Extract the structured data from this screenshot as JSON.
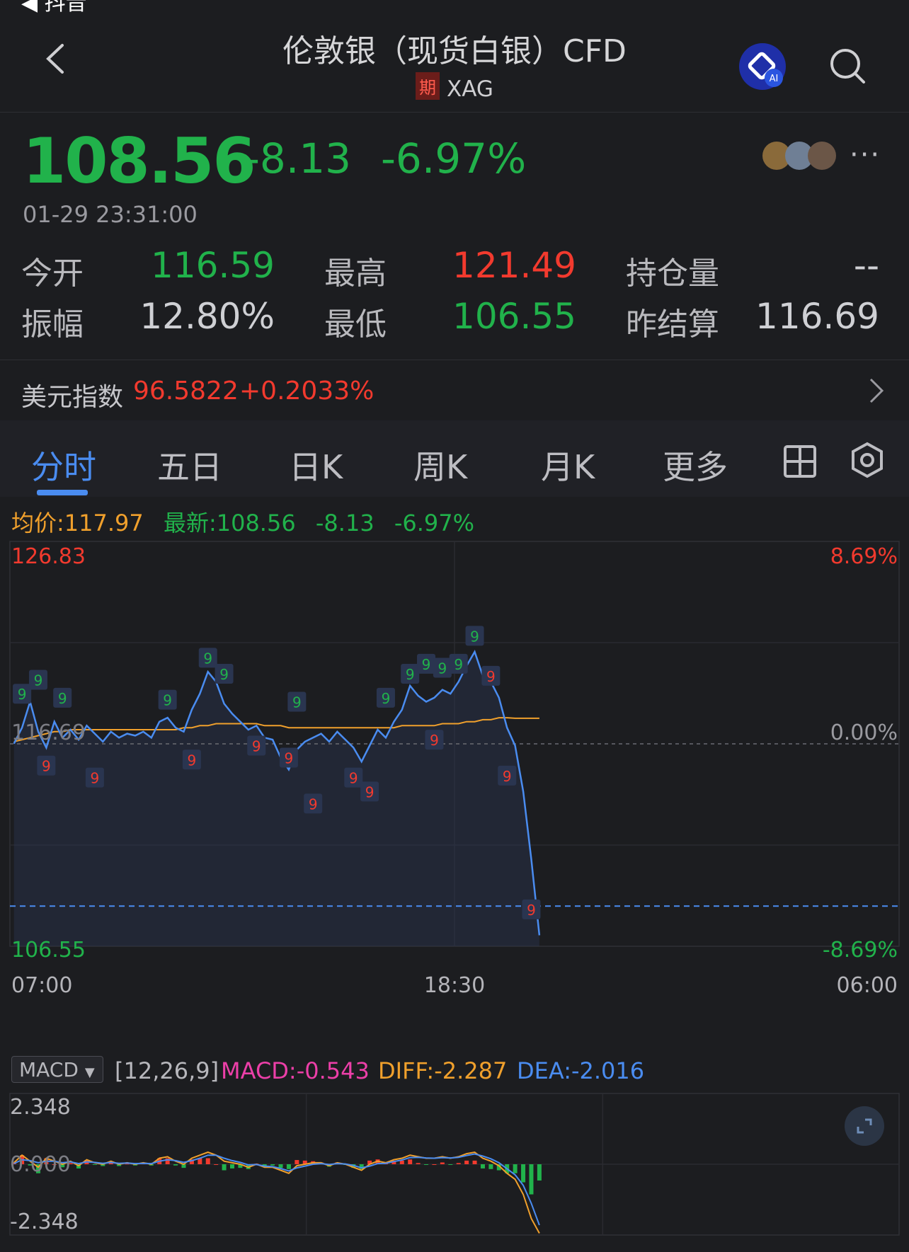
{
  "status_bar": {
    "back_app": "◀ 抖音"
  },
  "header": {
    "title": "伦敦银（现货白银）CFD",
    "tag": "期",
    "symbol": "XAG"
  },
  "quote": {
    "price": "108.56",
    "change": "-8.13",
    "change_pct": "-6.97%",
    "time": "01-29 23:31:00",
    "more": "···",
    "stats": [
      {
        "label": "今开",
        "value": "116.59",
        "color": "green"
      },
      {
        "label": "最高",
        "value": "121.49",
        "color": "red"
      },
      {
        "label": "持仓量",
        "value": "--",
        "color": "grey"
      },
      {
        "label": "振幅",
        "value": "12.80%",
        "color": "grey"
      },
      {
        "label": "最低",
        "value": "106.55",
        "color": "green"
      },
      {
        "label": "昨结算",
        "value": "116.69",
        "color": "grey"
      }
    ]
  },
  "usd_index": {
    "label": "美元指数",
    "value": "96.5822",
    "change_pct": "+0.2033%"
  },
  "tabs": [
    "分时",
    "五日",
    "日K",
    "周K",
    "月K",
    "更多"
  ],
  "legend": {
    "avg": "均价:117.97",
    "latest": "最新:108.56",
    "change": "-8.13",
    "pct": "-6.97%"
  },
  "chart_data": {
    "type": "line",
    "y_max_label": "126.83",
    "y_min_label": "106.55",
    "y_mid_label": "116.69",
    "pct_max_label": "8.69%",
    "pct_mid_label": "0.00%",
    "pct_min_label": "-8.69%",
    "x_labels": [
      "07:00",
      "18:30",
      "06:00"
    ],
    "ylim": [
      106.55,
      126.83
    ],
    "prev_settle": 116.69,
    "current": 108.56,
    "series": [
      {
        "values": [
          116.7,
          117.5,
          118.8,
          117.3,
          116.5,
          117.8,
          117.0,
          117.4,
          116.9,
          117.6,
          117.2,
          116.8,
          117.3,
          117.0,
          117.2,
          117.1,
          117.3,
          117.0,
          117.8,
          118.0,
          117.5,
          117.3,
          118.4,
          119.2,
          120.3,
          119.8,
          118.7,
          118.2,
          117.8,
          117.4,
          117.6,
          117.0,
          116.9,
          116.0,
          115.4,
          116.4,
          116.8,
          117.0,
          117.2,
          116.8,
          117.3,
          116.9,
          116.5,
          115.8,
          116.6,
          117.4,
          117.0,
          117.8,
          118.4,
          119.6,
          119.1,
          118.8,
          119.0,
          119.4,
          119.2,
          119.8,
          120.6,
          121.3,
          120.1,
          119.8,
          119.0,
          117.5,
          116.6,
          114.3,
          110.9,
          107.1
        ]
      },
      {
        "values": [
          116.8,
          116.9,
          117.0,
          117.1,
          117.2,
          117.3,
          117.3,
          117.4,
          117.4,
          117.4,
          117.4,
          117.4,
          117.4,
          117.4,
          117.4,
          117.4,
          117.4,
          117.4,
          117.4,
          117.4,
          117.4,
          117.5,
          117.5,
          117.6,
          117.6,
          117.7,
          117.7,
          117.7,
          117.7,
          117.7,
          117.7,
          117.6,
          117.6,
          117.6,
          117.5,
          117.5,
          117.5,
          117.5,
          117.5,
          117.5,
          117.5,
          117.5,
          117.5,
          117.5,
          117.5,
          117.5,
          117.5,
          117.5,
          117.6,
          117.6,
          117.6,
          117.6,
          117.6,
          117.7,
          117.7,
          117.7,
          117.8,
          117.8,
          117.9,
          117.9,
          118.0,
          118.0,
          117.97,
          117.97,
          117.97,
          117.97
        ]
      }
    ],
    "markers": [
      {
        "i": 1,
        "v": 119.2,
        "c": "g"
      },
      {
        "i": 3,
        "v": 119.9,
        "c": "g"
      },
      {
        "i": 4,
        "v": 115.6,
        "c": "r"
      },
      {
        "i": 6,
        "v": 119.0,
        "c": "g"
      },
      {
        "i": 10,
        "v": 115.0,
        "c": "r"
      },
      {
        "i": 19,
        "v": 118.9,
        "c": "g"
      },
      {
        "i": 22,
        "v": 115.9,
        "c": "r"
      },
      {
        "i": 24,
        "v": 121.0,
        "c": "g"
      },
      {
        "i": 26,
        "v": 120.2,
        "c": "g"
      },
      {
        "i": 30,
        "v": 116.6,
        "c": "r"
      },
      {
        "i": 34,
        "v": 116.0,
        "c": "r"
      },
      {
        "i": 35,
        "v": 118.8,
        "c": "g"
      },
      {
        "i": 37,
        "v": 113.7,
        "c": "r"
      },
      {
        "i": 42,
        "v": 115.0,
        "c": "r"
      },
      {
        "i": 44,
        "v": 114.3,
        "c": "r"
      },
      {
        "i": 46,
        "v": 119.0,
        "c": "g"
      },
      {
        "i": 49,
        "v": 120.2,
        "c": "g"
      },
      {
        "i": 51,
        "v": 120.7,
        "c": "g"
      },
      {
        "i": 52,
        "v": 116.9,
        "c": "r"
      },
      {
        "i": 53,
        "v": 120.5,
        "c": "g"
      },
      {
        "i": 55,
        "v": 120.7,
        "c": "g"
      },
      {
        "i": 57,
        "v": 122.1,
        "c": "g"
      },
      {
        "i": 59,
        "v": 120.1,
        "c": "r"
      },
      {
        "i": 61,
        "v": 115.1,
        "c": "r"
      },
      {
        "i": 64,
        "v": 108.4,
        "c": "r"
      }
    ]
  },
  "macd": {
    "selector": "MACD",
    "params": "[12,26,9]",
    "macd": "MACD:-0.543",
    "diff": "DIFF:-2.287",
    "dea": "DEA:-2.016",
    "y_max_label": "2.348",
    "y_mid_label": "0.000",
    "y_min_label": "-2.348",
    "chart_data": {
      "type": "line",
      "ylim": [
        -2.348,
        2.348
      ],
      "diff": [
        0.05,
        0.3,
        0.1,
        -0.1,
        0.2,
        0.1,
        0.0,
        0.1,
        -0.05,
        0.15,
        0.05,
        0.0,
        0.1,
        0.0,
        0.05,
        0.0,
        0.05,
        0.0,
        0.2,
        0.25,
        0.1,
        0.0,
        0.2,
        0.3,
        0.4,
        0.3,
        0.1,
        0.05,
        0.0,
        -0.1,
        0.0,
        -0.1,
        -0.1,
        -0.2,
        -0.3,
        -0.05,
        0.0,
        0.05,
        0.05,
        -0.05,
        0.05,
        0.0,
        -0.1,
        -0.2,
        0.0,
        0.1,
        0.05,
        0.15,
        0.2,
        0.3,
        0.25,
        0.2,
        0.2,
        0.25,
        0.2,
        0.25,
        0.35,
        0.4,
        0.2,
        0.1,
        -0.05,
        -0.3,
        -0.5,
        -1.0,
        -1.8,
        -2.29
      ],
      "dea": [
        0.02,
        0.15,
        0.12,
        0.05,
        0.1,
        0.1,
        0.05,
        0.08,
        0.02,
        0.08,
        0.06,
        0.03,
        0.06,
        0.03,
        0.04,
        0.02,
        0.03,
        0.02,
        0.1,
        0.15,
        0.12,
        0.06,
        0.12,
        0.2,
        0.3,
        0.3,
        0.2,
        0.12,
        0.06,
        -0.02,
        -0.01,
        -0.06,
        -0.08,
        -0.14,
        -0.22,
        -0.12,
        -0.06,
        0.0,
        0.02,
        -0.01,
        0.02,
        0.01,
        -0.04,
        -0.12,
        -0.06,
        0.02,
        0.03,
        0.09,
        0.14,
        0.22,
        0.23,
        0.21,
        0.2,
        0.22,
        0.21,
        0.23,
        0.29,
        0.34,
        0.27,
        0.18,
        0.05,
        -0.15,
        -0.35,
        -0.7,
        -1.3,
        -2.02
      ]
    }
  }
}
